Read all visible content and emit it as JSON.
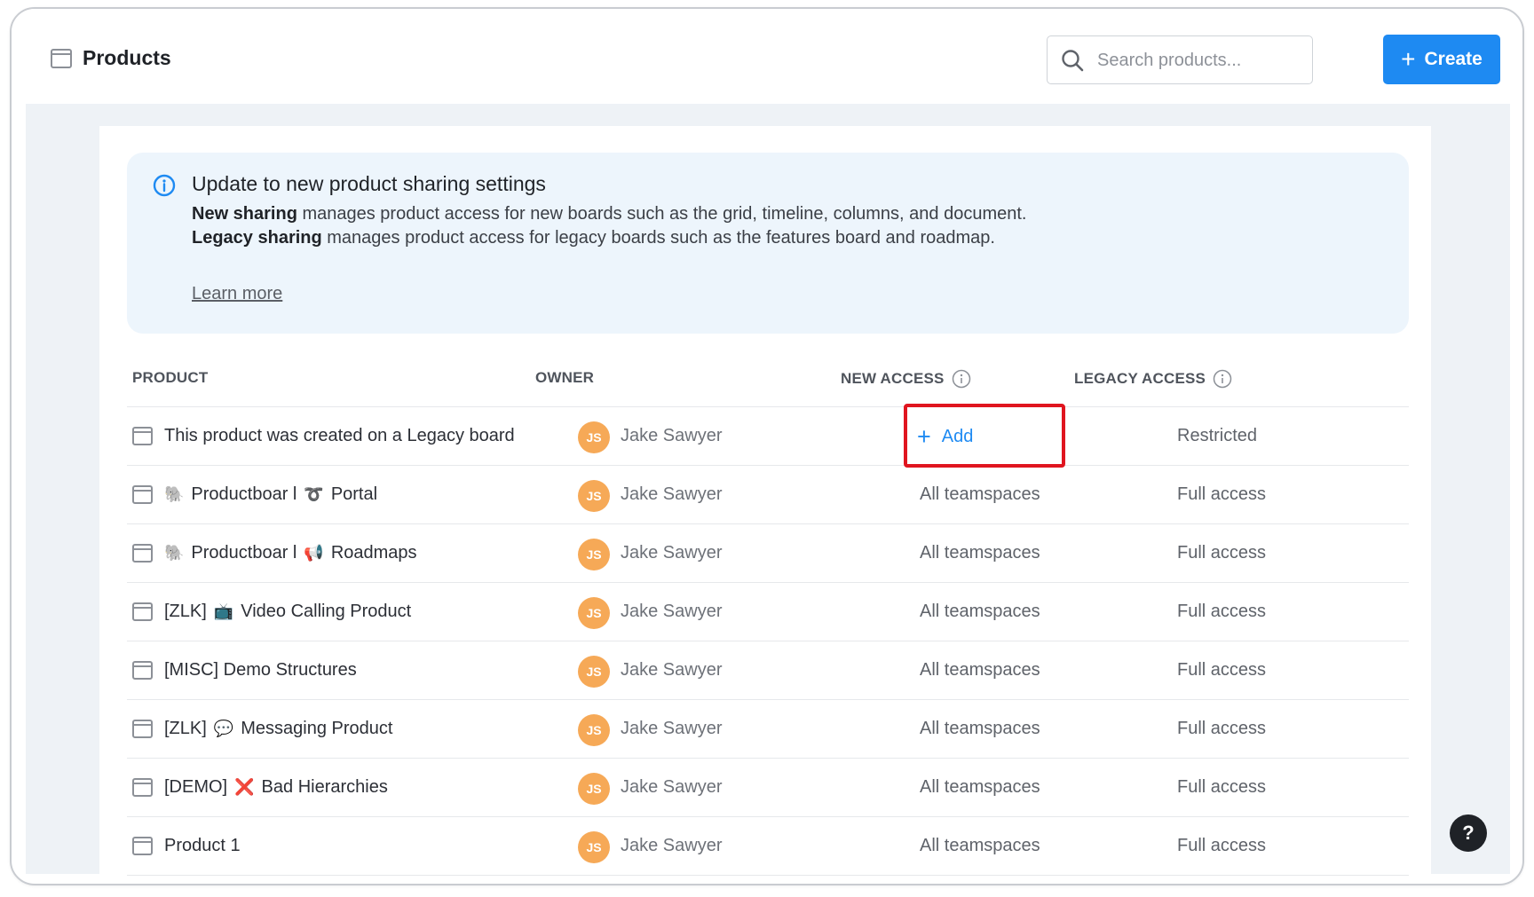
{
  "header": {
    "title": "Products",
    "search_placeholder": "Search products...",
    "create_label": "Create"
  },
  "banner": {
    "title": "Update to new product sharing settings",
    "line1_bold": "New sharing",
    "line1_rest": " manages product access for new boards such as the grid, timeline, columns, and document.",
    "line2_bold": "Legacy sharing",
    "line2_rest": " manages product access for legacy boards such as the features board and roadmap.",
    "learn_more": "Learn more"
  },
  "table": {
    "columns": {
      "product": "PRODUCT",
      "owner": "OWNER",
      "new_access": "NEW ACCESS",
      "legacy_access": "LEGACY ACCESS"
    },
    "add_label": "Add",
    "rows": [
      {
        "prefix": "",
        "emoji1": "",
        "name1": "This product was created on a Legacy board",
        "emoji2": "",
        "name2": "",
        "owner_initials": "JS",
        "owner": "Jake Sawyer",
        "new_access": "",
        "legacy_access": "Restricted"
      },
      {
        "prefix": "",
        "emoji1": "🐘",
        "name1": "Productboar l",
        "emoji2": "➰",
        "name2": "Portal",
        "owner_initials": "JS",
        "owner": "Jake Sawyer",
        "new_access": "All teamspaces",
        "legacy_access": "Full access"
      },
      {
        "prefix": "",
        "emoji1": "🐘",
        "name1": "Productboar l",
        "emoji2": "📢",
        "name2": "Roadmaps",
        "owner_initials": "JS",
        "owner": "Jake Sawyer",
        "new_access": "All teamspaces",
        "legacy_access": "Full access"
      },
      {
        "prefix": "[ZLK]",
        "emoji1": "📺",
        "name1": "Video Calling Product",
        "emoji2": "",
        "name2": "",
        "owner_initials": "JS",
        "owner": "Jake Sawyer",
        "new_access": "All teamspaces",
        "legacy_access": "Full access"
      },
      {
        "prefix": "",
        "emoji1": "",
        "name1": "[MISC] Demo Structures",
        "emoji2": "",
        "name2": "",
        "owner_initials": "JS",
        "owner": "Jake Sawyer",
        "new_access": "All teamspaces",
        "legacy_access": "Full access"
      },
      {
        "prefix": "[ZLK]",
        "emoji1": "💬",
        "name1": "Messaging Product",
        "emoji2": "",
        "name2": "",
        "owner_initials": "JS",
        "owner": "Jake Sawyer",
        "new_access": "All teamspaces",
        "legacy_access": "Full access"
      },
      {
        "prefix": "[DEMO]",
        "emoji1": "❌",
        "name1": "Bad Hierarchies",
        "emoji2": "",
        "name2": "",
        "owner_initials": "JS",
        "owner": "Jake Sawyer",
        "new_access": "All teamspaces",
        "legacy_access": "Full access"
      },
      {
        "prefix": "",
        "emoji1": "",
        "name1": "Product 1",
        "emoji2": "",
        "name2": "",
        "owner_initials": "JS",
        "owner": "Jake Sawyer",
        "new_access": "All teamspaces",
        "legacy_access": "Full access"
      }
    ]
  },
  "help_label": "?",
  "colors": {
    "accent": "#1e8af2",
    "banner_bg": "#edf5fc",
    "avatar": "#f6a957",
    "highlight": "#e0151f"
  }
}
